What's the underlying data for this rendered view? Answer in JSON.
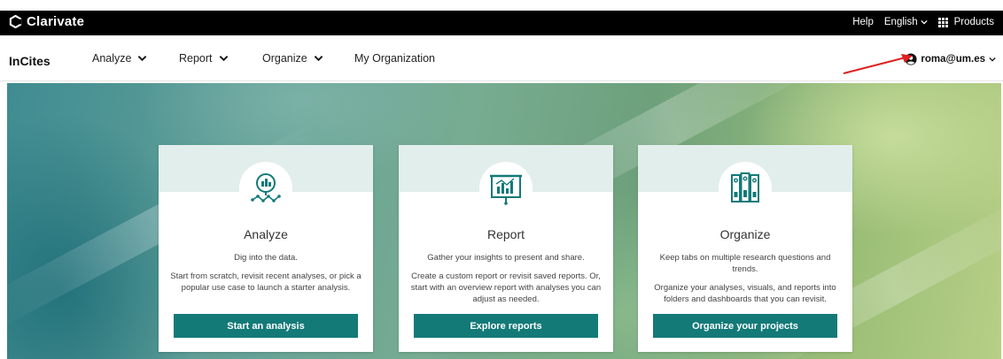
{
  "brand": {
    "name": "Clarivate",
    "icon": "clarivate-logo-icon"
  },
  "topbar": {
    "help": "Help",
    "language": "English",
    "products": "Products",
    "products_icon": "grid-icon"
  },
  "navbar": {
    "product_name": "InCites",
    "items": [
      {
        "label": "Analyze",
        "has_dropdown": true
      },
      {
        "label": "Report",
        "has_dropdown": true
      },
      {
        "label": "Organize",
        "has_dropdown": true
      },
      {
        "label": "My Organization",
        "has_dropdown": false
      }
    ],
    "user": {
      "email": "roma@um.es",
      "icon": "user-circle-icon"
    }
  },
  "annotation": {
    "arrow_color": "#e02020"
  },
  "cards": [
    {
      "icon": "analyze-magnifier-chart-icon",
      "title": "Analyze",
      "headline": "Dig into the data.",
      "description": "Start from scratch, revisit recent analyses, or pick a popular use case to launch a starter analysis.",
      "button": "Start an analysis"
    },
    {
      "icon": "report-presentation-board-icon",
      "title": "Report",
      "headline": "Gather your insights to present and share.",
      "description": "Create a custom report or revisit saved reports. Or, start with an overview report with analyses you can adjust as needed.",
      "button": "Explore reports"
    },
    {
      "icon": "organize-binders-icon",
      "title": "Organize",
      "headline": "Keep tabs on multiple research questions and trends.",
      "description": "Organize your analyses, visuals, and reports into folders and dashboards that you can revisit.",
      "button": "Organize your projects"
    }
  ],
  "colors": {
    "accent": "#137a78",
    "card_band": "#e2eeec",
    "topbar": "#000000"
  }
}
